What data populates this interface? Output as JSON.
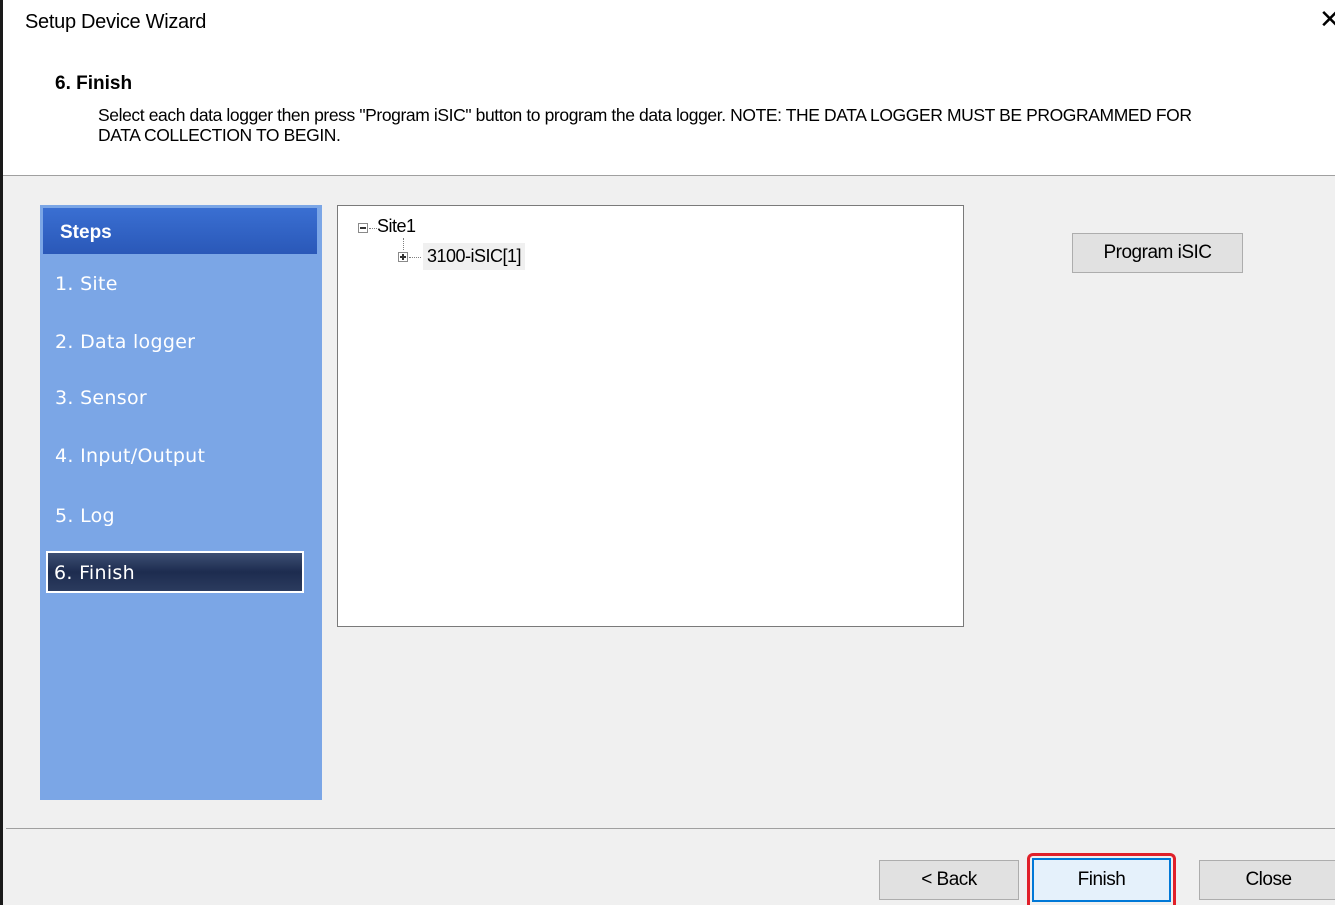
{
  "window": {
    "title": "Setup Device Wizard",
    "close_glyph": "✕"
  },
  "header": {
    "step_title": "6. Finish",
    "description": "Select each data logger then press \"Program iSIC\" button to program the data logger.  NOTE: THE DATA LOGGER MUST BE PROGRAMMED FOR DATA COLLECTION TO BEGIN."
  },
  "steps": {
    "heading": "Steps",
    "items": [
      {
        "label": "1. Site"
      },
      {
        "label": "2. Data logger"
      },
      {
        "label": "3. Sensor"
      },
      {
        "label": "4. Input/Output"
      },
      {
        "label": "5. Log"
      },
      {
        "label": "6. Finish"
      }
    ],
    "active_index": 5
  },
  "tree": {
    "root": {
      "label": "Site1",
      "expanded": true
    },
    "child": {
      "label": "3100-iSIC[1]",
      "expanded": false,
      "selected": true
    }
  },
  "buttons": {
    "program": "Program iSIC",
    "back": "< Back",
    "finish": "Finish",
    "close": "Close"
  },
  "colors": {
    "steps_panel": "#7ba6e6",
    "steps_header": "#2f63c4",
    "active_step": "#1d2c4f",
    "highlight": "#e0202a"
  }
}
